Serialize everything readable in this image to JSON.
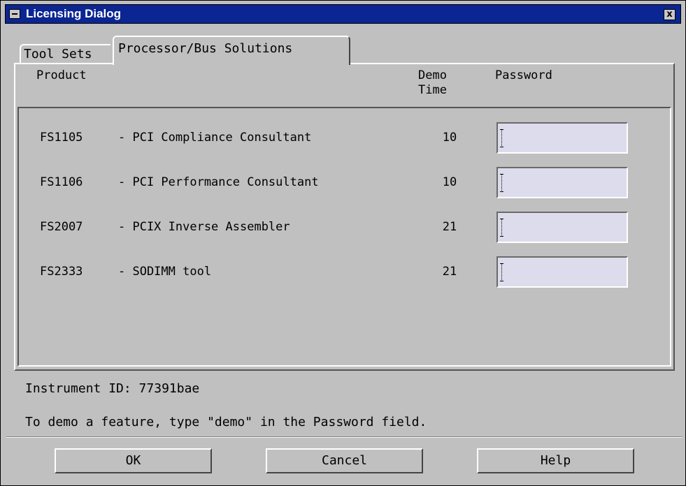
{
  "window": {
    "title": "Licensing Dialog",
    "close_label": "x"
  },
  "tabs": [
    {
      "label": "Tool Sets",
      "active": false
    },
    {
      "label": "Processor/Bus Solutions",
      "active": true
    }
  ],
  "table": {
    "headers": {
      "product": "Product",
      "demo_time_line1": "Demo",
      "demo_time_line2": "Time",
      "password": "Password"
    },
    "rows": [
      {
        "code": "FS1105",
        "name": "- PCI Compliance Consultant",
        "demo_time": "10",
        "password": ""
      },
      {
        "code": "FS1106",
        "name": "- PCI Performance Consultant",
        "demo_time": "10",
        "password": ""
      },
      {
        "code": "FS2007",
        "name": "- PCIX Inverse Assembler",
        "demo_time": "21",
        "password": ""
      },
      {
        "code": "FS2333",
        "name": "- SODIMM tool",
        "demo_time": "21",
        "password": ""
      }
    ]
  },
  "instrument_id": "Instrument ID: 77391bae",
  "hint": "To demo a feature, type \"demo\" in the Password field.",
  "buttons": {
    "ok": "OK",
    "cancel": "Cancel",
    "help": "Help"
  },
  "colors": {
    "titlebar": "#0b2593",
    "background": "#c0c0c0",
    "field": "#dcdcec"
  }
}
